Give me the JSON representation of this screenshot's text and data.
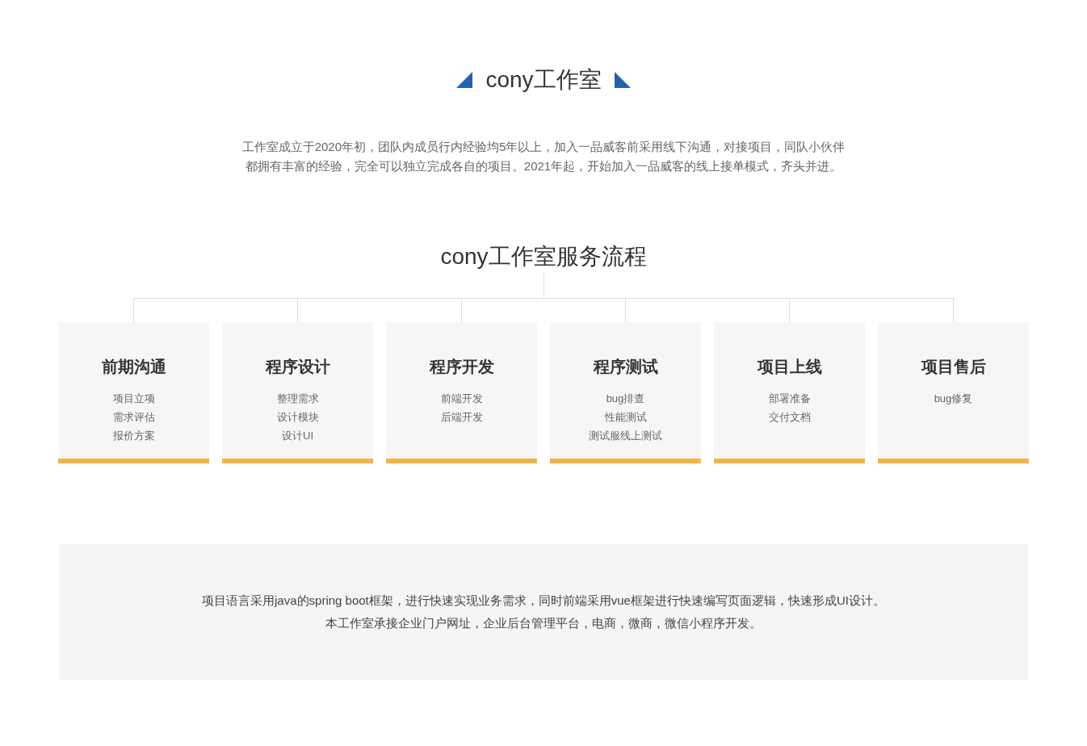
{
  "header": {
    "title": "cony工作室"
  },
  "intro": [
    "工作室成立于2020年初，团队内成员行内经验均5年以上，加入一品威客前采用线下沟通，对接项目，同队小伙伴",
    "都拥有丰富的经验，完全可以独立完成各自的项目。2021年起，开始加入一品威客的线上接单模式，齐头并进。"
  ],
  "process": {
    "title": "cony工作室服务流程",
    "steps": [
      {
        "title": "前期沟通",
        "items": [
          "项目立项",
          "需求评估",
          "报价方案"
        ]
      },
      {
        "title": "程序设计",
        "items": [
          "整理需求",
          "设计模块",
          "设计UI"
        ]
      },
      {
        "title": "程序开发",
        "items": [
          "前端开发",
          "后端开发"
        ]
      },
      {
        "title": "程序测试",
        "items": [
          "bug排查",
          "性能测试",
          "测试服线上测试"
        ]
      },
      {
        "title": "项目上线",
        "items": [
          "部署准备",
          "交付文档"
        ]
      },
      {
        "title": "项目售后",
        "items": [
          "bug修复"
        ]
      }
    ]
  },
  "summary": [
    "项目语言采用java的spring boot框架，进行快速实现业务需求，同时前端采用vue框架进行快速编写页面逻辑，快速形成UI设计。",
    "本工作室承接企业门户网址，企业后台管理平台，电商，微商，微信小程序开发。"
  ]
}
